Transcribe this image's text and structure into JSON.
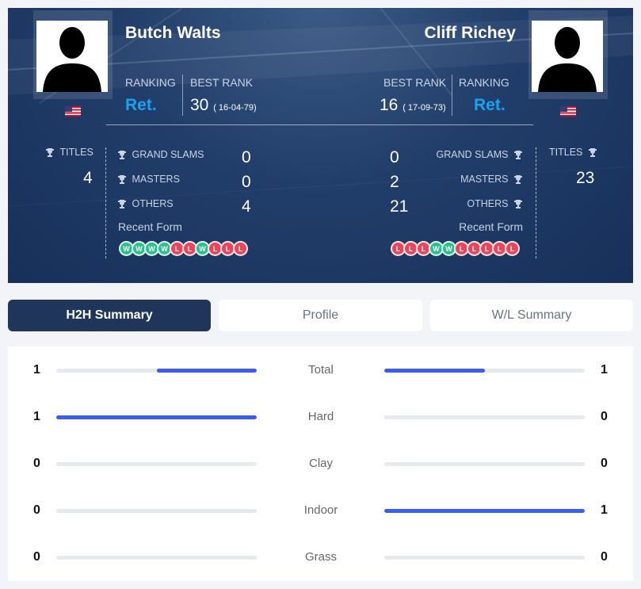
{
  "player1": {
    "name": "Butch Walts",
    "ranking_label": "RANKING",
    "ranking": "Ret.",
    "best_rank_label": "BEST RANK",
    "best_rank": "30",
    "best_rank_date": "( 16-04-79)",
    "titles_label": "TITLES",
    "titles": "4",
    "grand_slams_label": "GRAND SLAMS",
    "grand_slams": "0",
    "masters_label": "MASTERS",
    "masters": "0",
    "others_label": "OTHERS",
    "others": "4",
    "recent_form_label": "Recent Form",
    "recent_form": [
      "W",
      "W",
      "W",
      "W",
      "L",
      "L",
      "W",
      "L",
      "L",
      "L"
    ]
  },
  "player2": {
    "name": "Cliff Richey",
    "ranking_label": "RANKING",
    "ranking": "Ret.",
    "best_rank_label": "BEST RANK",
    "best_rank": "16",
    "best_rank_date": "( 17-09-73)",
    "titles_label": "TITLES",
    "titles": "23",
    "grand_slams_label": "GRAND SLAMS",
    "grand_slams": "0",
    "masters_label": "MASTERS",
    "masters": "2",
    "others_label": "OTHERS",
    "others": "21",
    "recent_form_label": "Recent Form",
    "recent_form": [
      "L",
      "L",
      "L",
      "W",
      "W",
      "L",
      "L",
      "L",
      "L",
      "L"
    ]
  },
  "tabs": [
    {
      "label": "H2H Summary",
      "active": true
    },
    {
      "label": "Profile",
      "active": false
    },
    {
      "label": "W/L Summary",
      "active": false
    }
  ],
  "summary": [
    {
      "category": "Total",
      "left": "1",
      "right": "1",
      "left_fraction": 0.5,
      "right_fraction": 0.5
    },
    {
      "category": "Hard",
      "left": "1",
      "right": "0",
      "left_fraction": 1.0,
      "right_fraction": 0.0
    },
    {
      "category": "Clay",
      "left": "0",
      "right": "0",
      "left_fraction": 0.0,
      "right_fraction": 0.0
    },
    {
      "category": "Indoor",
      "left": "0",
      "right": "1",
      "left_fraction": 0.0,
      "right_fraction": 1.0
    },
    {
      "category": "Grass",
      "left": "0",
      "right": "0",
      "left_fraction": 0.0,
      "right_fraction": 0.0
    }
  ],
  "colors": {
    "win": "#2bbf8c",
    "loss": "#e8465b",
    "bar": "#3a5ee8",
    "ranking": "#1ba1ee",
    "tab_active": "#1f355a"
  }
}
